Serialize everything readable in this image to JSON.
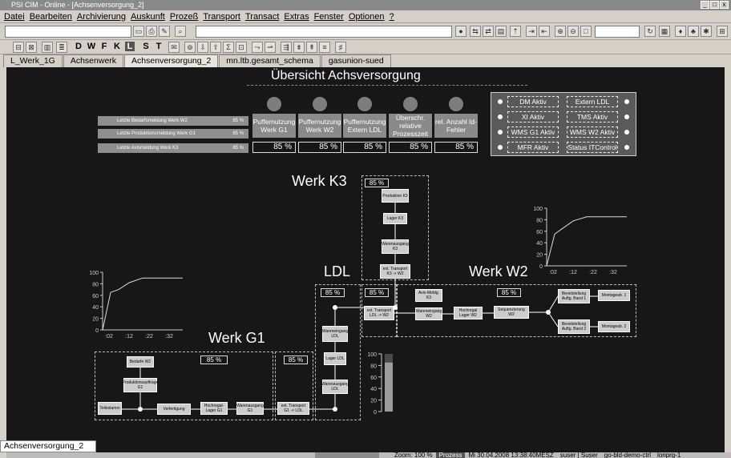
{
  "window": {
    "title": "PSI CIM - Online - [Achsenversorgung_2]"
  },
  "menu": [
    "Datei",
    "Bearbeiten",
    "Archivierung",
    "Auskunft",
    "Prozeß",
    "Transport",
    "Transact",
    "Extras",
    "Fenster",
    "Optionen",
    "?"
  ],
  "toolbar2": {
    "letters": [
      "D",
      "W",
      "F",
      "K",
      "L",
      "S",
      "T"
    ]
  },
  "tabs": [
    "L_Werk_1G",
    "Achsenwerk",
    "Achsenversorgung_2",
    "mn.ltb.gesamt_schema",
    "gasunion-sued"
  ],
  "bottom_tab": "Achsenversorgung_2",
  "status": {
    "zoom": "Zoom: 100 %",
    "mode": "Prozess",
    "datetime": "Mi 30.04.2008 13:38:40MESZ",
    "user": "suser | Suser",
    "host": "go-bld-demo-ctrl",
    "page": "lonprg-1"
  },
  "header": {
    "title": "Übersicht Achsversorgung"
  },
  "meldungen": [
    {
      "label": "Letzte Bedarfsmeldung Werk W2",
      "value": "85 %"
    },
    {
      "label": "Letzte Produktionsmeldung Werk G1",
      "value": "85 %"
    },
    {
      "label": "Letzte Avismeldung Werk K3",
      "value": "85 %"
    }
  ],
  "buffers": [
    {
      "label": "Puffernutzung Werk G1",
      "value": "85 %"
    },
    {
      "label": "Puffernutzung Werk W2",
      "value": "85 %"
    },
    {
      "label": "Puffernutzung Extern LDL",
      "value": "85 %"
    },
    {
      "label": "Überschr. relative Prozesszeit",
      "value": "85 %"
    },
    {
      "label": "rel. Anzahl Id-Fehler",
      "value": "85 %"
    }
  ],
  "status_panel": {
    "left": [
      "DM Aktiv",
      "XI Aktiv",
      "WMS G1 Aktiv",
      "MFR Aktiv"
    ],
    "right": [
      "Extern LDL",
      "TMS Aktiv",
      "WMS W2 Aktiv",
      "Status ITControl"
    ]
  },
  "areas": {
    "k3": {
      "title": "Werk K3",
      "pct": "85 %",
      "steps": [
        "Produktion K3",
        "Lager K3",
        "Warenausgang K3",
        "ext. Transport K3 -> W2"
      ]
    },
    "ldl": {
      "title": "LDL",
      "pct": "85 %",
      "steps": [
        "Wareneingang LDL",
        "Lager LDL",
        "Warenausgang LDL"
      ]
    },
    "w2": {
      "title": "Werk W2",
      "pct": "85 %",
      "pct_left": "85 %",
      "steps": [
        "ext. Transport LDL -> W2",
        "Avis-Meldg. K3",
        "Wareneingang W2",
        "Hochregal Lager W2",
        "Sequenzierung W2",
        "Bereitstellung Auftg. Band 1",
        "Montageab. 1",
        "Bereitstellung Auftg. Band 2",
        "Montageab. 2"
      ]
    },
    "g1": {
      "title": "Werk G1",
      "pct": "85 %",
      "pct2": "85 %",
      "steps": [
        "Bedarfe W2",
        "Produktionsaufträge G1",
        "Teilestamm",
        "Verfertigung",
        "Hochregal-Lager G1",
        "Warenausgang G1",
        "ext. Transport G1 -> LDL"
      ]
    }
  },
  "chart_data": [
    {
      "type": "line",
      "title": "",
      "xlabel": "",
      "ylabel": "",
      "ylim": [
        0,
        100
      ],
      "y_ticks": [
        "100",
        "80",
        "60",
        "40",
        "20",
        "0"
      ],
      "x_ticks": [
        ":02",
        ":12",
        ":22",
        ":32"
      ],
      "x": [
        0,
        3,
        6,
        10,
        15,
        20,
        25,
        30
      ],
      "values": [
        0,
        65,
        70,
        82,
        90,
        90,
        90,
        90
      ]
    },
    {
      "type": "line",
      "title": "",
      "xlabel": "",
      "ylabel": "",
      "ylim": [
        0,
        100
      ],
      "y_ticks": [
        "100",
        "80",
        "60",
        "40",
        "20",
        "0"
      ],
      "x_ticks": [
        ":02",
        ":12",
        ":22",
        ":32"
      ],
      "x": [
        0,
        3,
        6,
        10,
        15,
        20,
        25,
        30
      ],
      "values": [
        0,
        55,
        65,
        78,
        85,
        85,
        85,
        85
      ]
    },
    {
      "type": "bar",
      "title": "",
      "ylim": [
        0,
        100
      ],
      "y_ticks": [
        "100",
        "80",
        "60",
        "40",
        "20",
        "0"
      ],
      "values": [
        85
      ]
    }
  ]
}
